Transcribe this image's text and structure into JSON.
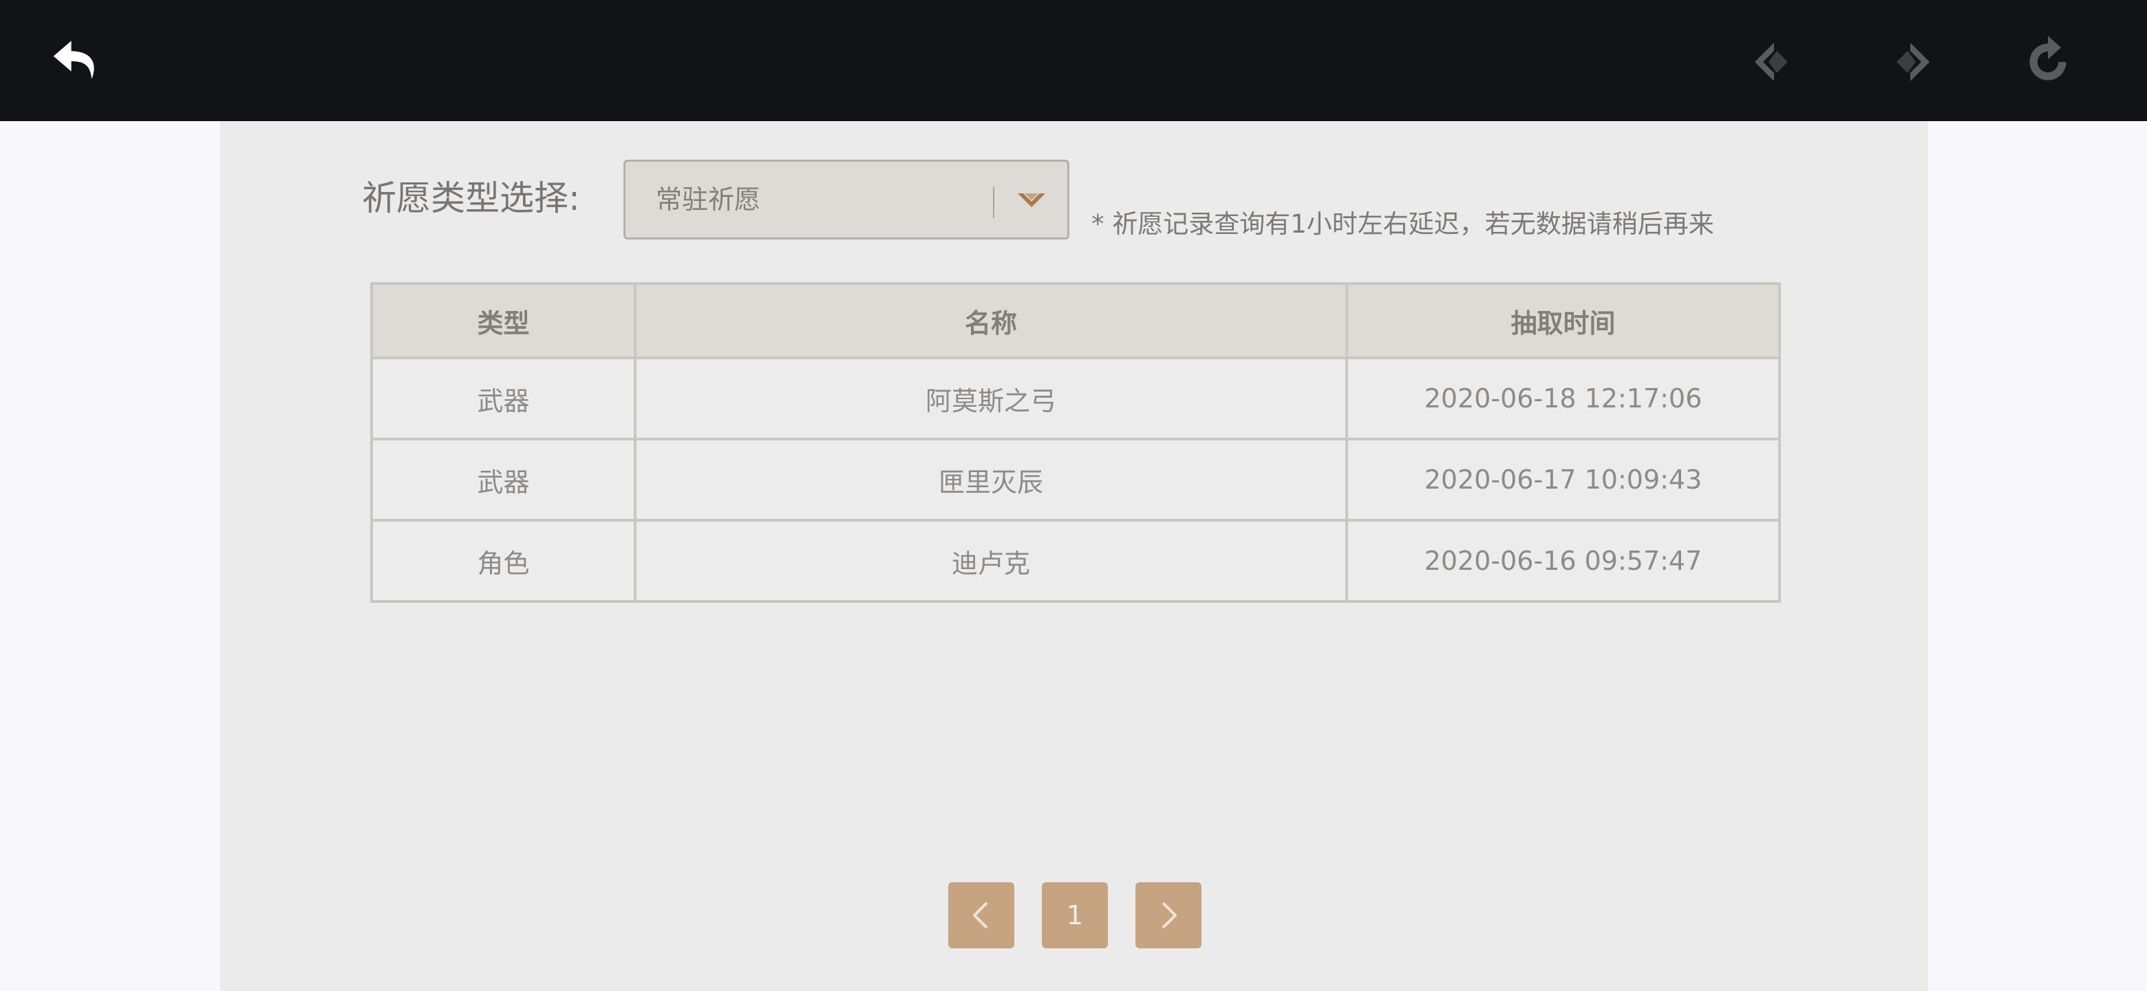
{
  "toolbar": {
    "back_icon": "back-arrow-icon",
    "prev_icon": "diamond-left-icon",
    "next_icon": "diamond-right-icon",
    "refresh_icon": "refresh-icon"
  },
  "filter": {
    "label": "祈愿类型选择:",
    "selected": "常驻祈愿",
    "notice": "* 祈愿记录查询有1小时左右延迟，若无数据请稍后再来"
  },
  "table": {
    "headers": [
      "类型",
      "名称",
      "抽取时间"
    ],
    "rows": [
      {
        "type": "武器",
        "name": "阿莫斯之弓",
        "time": "2020-06-18 12:17:06"
      },
      {
        "type": "武器",
        "name": "匣里灭辰",
        "time": "2020-06-17 10:09:43"
      },
      {
        "type": "角色",
        "name": "迪卢克",
        "time": "2020-06-16 09:57:47"
      }
    ]
  },
  "pagination": {
    "current_page": "1"
  },
  "colors": {
    "topbar": "#121316",
    "panel": "#ebebeb",
    "accent": "#c6a381",
    "header_bg": "#dedbd7"
  }
}
